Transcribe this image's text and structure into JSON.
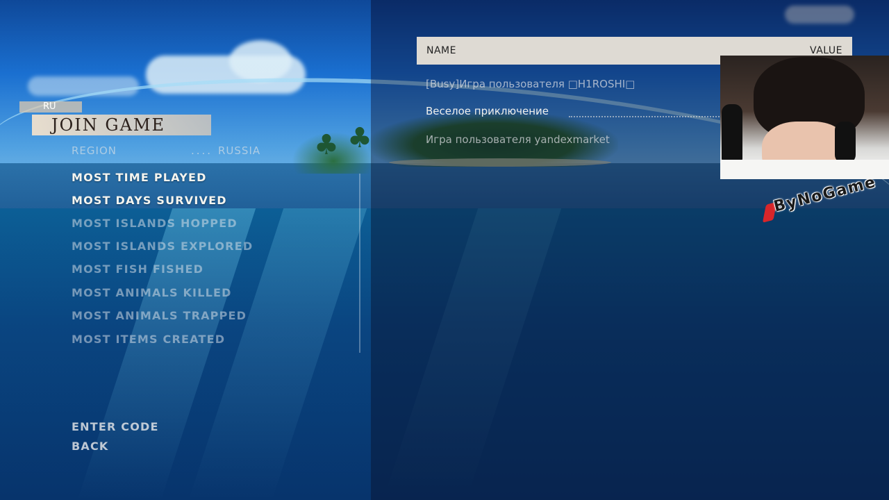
{
  "menu": {
    "language_tag": "RU",
    "title": "JOIN GAME",
    "region": {
      "label": "REGION",
      "dots": "....",
      "value": "RUSSIA"
    },
    "items": [
      {
        "label": "MOST TIME PLAYED",
        "state": "active"
      },
      {
        "label": "MOST DAYS SURVIVED",
        "state": "active"
      },
      {
        "label": "MOST ISLANDS HOPPED",
        "state": "dim"
      },
      {
        "label": "MOST ISLANDS EXPLORED",
        "state": "dim"
      },
      {
        "label": "MOST FISH FISHED",
        "state": "dim"
      },
      {
        "label": "MOST ANIMALS KILLED",
        "state": "dim"
      },
      {
        "label": "MOST ANIMALS TRAPPED",
        "state": "dim"
      },
      {
        "label": "MOST ITEMS CREATED",
        "state": "dim"
      }
    ],
    "enter_code": "ENTER CODE",
    "back": "BACK"
  },
  "lobby_table": {
    "header": {
      "name": "NAME",
      "value": "VALUE"
    },
    "rows": [
      {
        "name": "[Busy]Игра пользователя □H1ROSHI□"
      },
      {
        "name": "Веселое приключение"
      },
      {
        "name": "Игра пользователя yandexmarket"
      }
    ]
  },
  "overlay": {
    "watermark": "ByNoGame"
  },
  "colors": {
    "header_bg": "#dedad3",
    "title_strip": "#eadcc9",
    "watermark_slash": "#d8262a"
  }
}
